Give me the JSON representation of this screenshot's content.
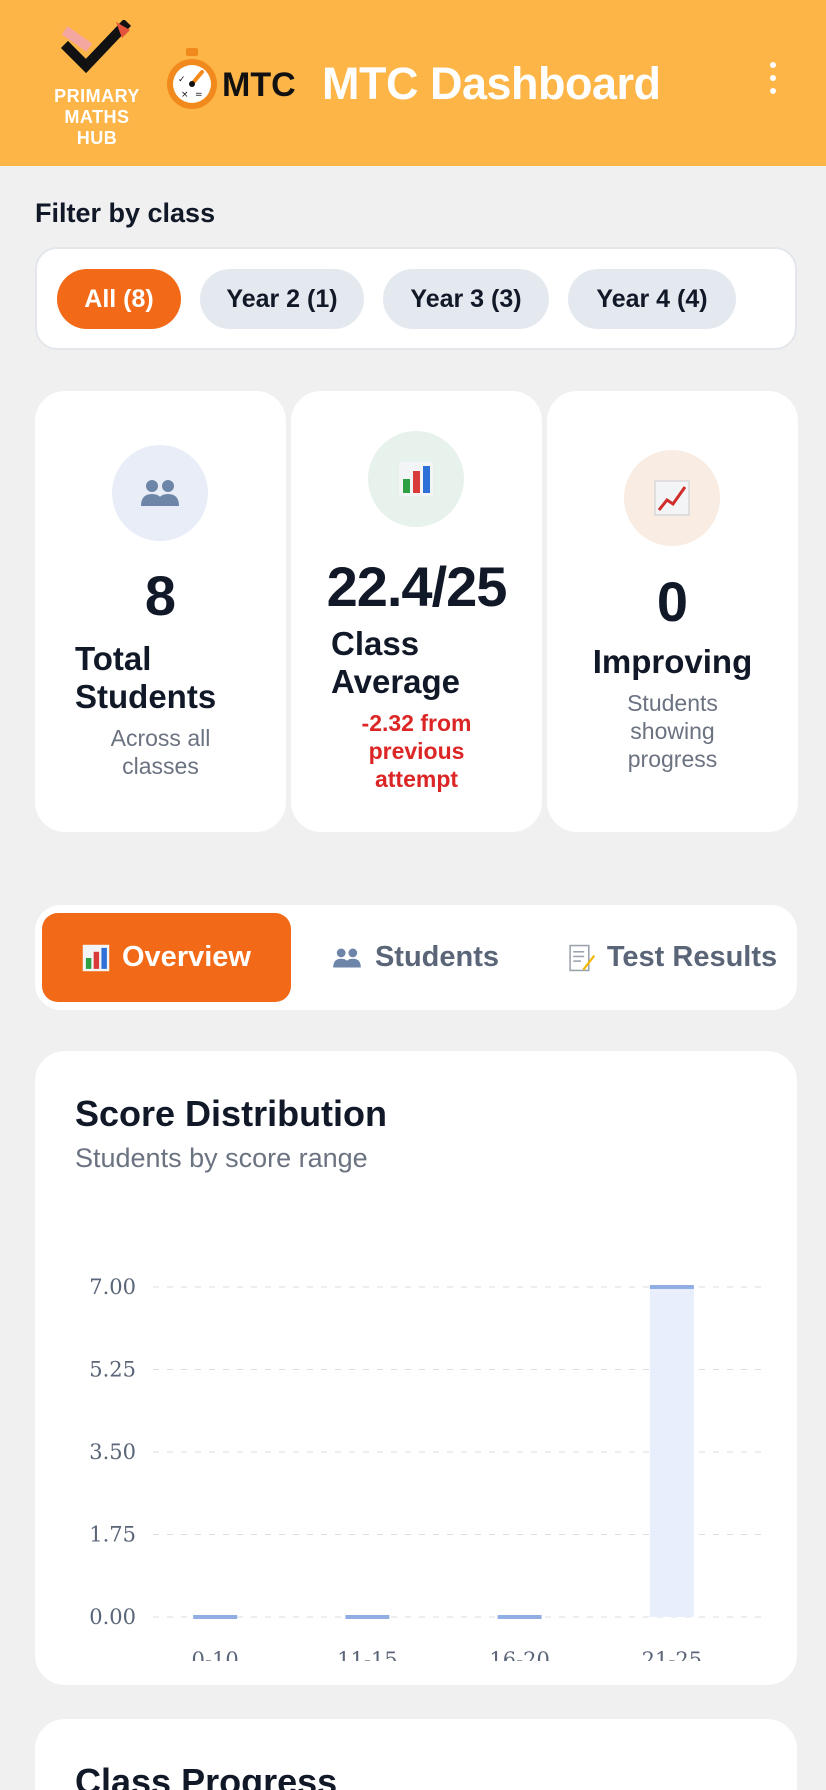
{
  "header": {
    "logo_text": "PRIMARY MATHS HUB",
    "logo_lines": [
      "PRIMARY",
      "MATHS",
      "HUB"
    ],
    "mtc_logo_text": "MTC",
    "title": "MTC Dashboard",
    "menu_icon": "kebab-vertical-icon"
  },
  "filter": {
    "label": "Filter by class",
    "chips": [
      {
        "label": "All (8)",
        "active": true
      },
      {
        "label": "Year 2 (1)",
        "active": false
      },
      {
        "label": "Year 3 (3)",
        "active": false
      },
      {
        "label": "Year 4 (4)",
        "active": false
      }
    ]
  },
  "stats": [
    {
      "icon": "people-icon",
      "value": "8",
      "title": "Total Students",
      "title_lines": [
        "Total",
        "Students"
      ],
      "sub": "Across all classes",
      "sub_lines": [
        "Across all",
        "classes"
      ]
    },
    {
      "icon": "bar-chart-icon",
      "value": "22.4/25",
      "title": "Class Average",
      "title_lines": [
        "Class",
        "Average"
      ],
      "delta": "-2.32 from previous attempt",
      "delta_lines": [
        "-2.32 from",
        "previous",
        "attempt"
      ]
    },
    {
      "icon": "trend-up-icon",
      "value": "0",
      "title": "Improving",
      "sub": "Students showing progress",
      "sub_lines": [
        "Students",
        "showing",
        "progress"
      ]
    }
  ],
  "tabs": [
    {
      "icon": "bar-chart-icon",
      "label": "Overview",
      "active": true
    },
    {
      "icon": "people-icon",
      "label": "Students",
      "active": false
    },
    {
      "icon": "memo-icon",
      "label": "Test Results",
      "active": false
    }
  ],
  "chart_section": {
    "title": "Score Distribution",
    "subtitle": "Students by score range"
  },
  "next_section": {
    "title": "Class Progress"
  },
  "colors": {
    "header": "#fdb547",
    "accent": "#f26a17",
    "bar_fill": "#e8eefc",
    "bar_stroke": "#90aee4",
    "negative": "#dc2626"
  },
  "chart_data": {
    "type": "bar",
    "title": "Score Distribution",
    "subtitle": "Students by score range",
    "categories": [
      "0-10",
      "11-15",
      "16-20",
      "21-25"
    ],
    "values": [
      0,
      0,
      0,
      7
    ],
    "ylim": [
      0,
      7
    ],
    "yticks": [
      "7.00",
      "5.25",
      "3.50",
      "1.75",
      "0.00"
    ],
    "grid": true,
    "legend": "none"
  }
}
